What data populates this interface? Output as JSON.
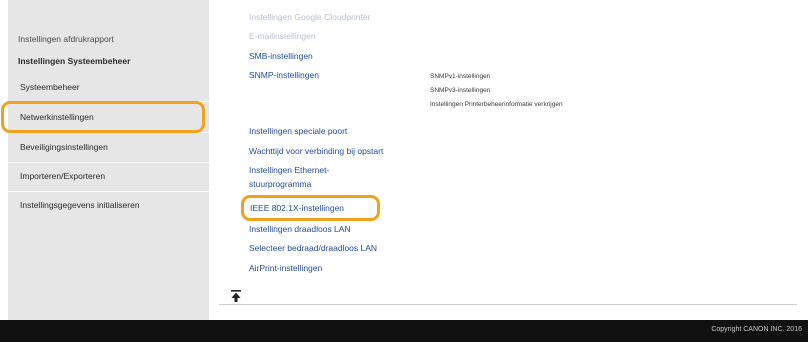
{
  "sidebar": {
    "items": [
      {
        "label": "Instellingen afdrukrapport"
      },
      {
        "label": "Instellingen Systeembeheer"
      },
      {
        "label": "Systeembeheer"
      },
      {
        "label": "Netwerkinstellingen"
      },
      {
        "label": "Beveiligingsinstellingen"
      },
      {
        "label": "Importeren/Exporteren"
      },
      {
        "label": "Instellingsgegevens initialiseren"
      }
    ]
  },
  "main": {
    "links": [
      {
        "label": "Instellingen Google Cloudprinter"
      },
      {
        "label": "E-mailinstellingen"
      },
      {
        "label": "SMB-instellingen"
      },
      {
        "label": "SNMP-instellingen"
      },
      {
        "label": "Instellingen speciale poort"
      },
      {
        "label": "Wachttijd voor verbinding bij opstart"
      },
      {
        "label": "Instellingen Ethernet-"
      },
      {
        "label": "stuurprogramma"
      },
      {
        "label": "IEEE 802.1X-instellingen"
      },
      {
        "label": "Instellingen draadloos LAN"
      },
      {
        "label": "Selecteer bedraad/draadloos LAN"
      },
      {
        "label": "AirPrint-instellingen"
      }
    ],
    "snmp_sublinks": [
      {
        "label": "SNMPv1-instellingen"
      },
      {
        "label": "SNMPv3-instellingen"
      },
      {
        "label": "Instellingen Printerbeheerinformatie verkrijgen"
      }
    ]
  },
  "footer": {
    "copyright": "Copyright CANON INC. 2016"
  },
  "colors": {
    "highlight": "#f0a21e",
    "link": "#1e4c9a",
    "sidebar_bg": "#e6e6e6",
    "footer_bg": "#111111"
  }
}
